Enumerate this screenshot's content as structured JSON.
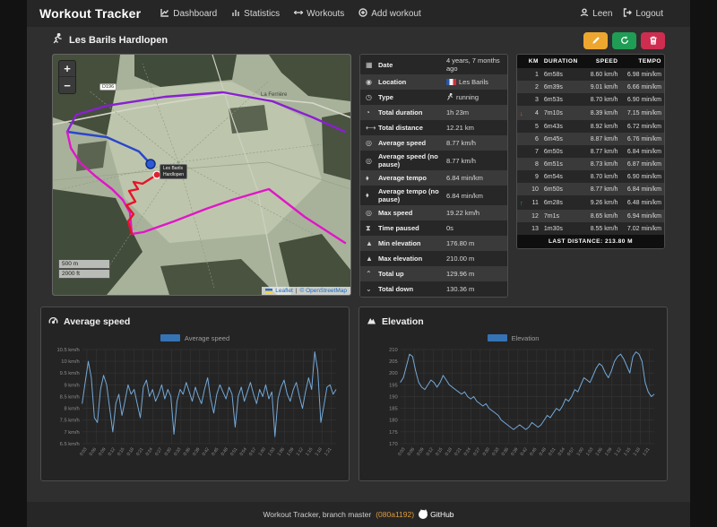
{
  "navbar": {
    "brand": "Workout Tracker",
    "items": [
      {
        "label": "Dashboard",
        "icon": "line-chart-icon"
      },
      {
        "label": "Statistics",
        "icon": "bar-chart-icon"
      },
      {
        "label": "Workouts",
        "icon": "dumbbell-icon"
      },
      {
        "label": "Add workout",
        "icon": "plus-circle-icon"
      }
    ],
    "user": {
      "label": "Leen",
      "icon": "user-icon"
    },
    "logout": {
      "label": "Logout",
      "icon": "logout-icon"
    }
  },
  "page": {
    "title": "Les Barils Hardlopen",
    "title_icon": "runner-icon",
    "actions": {
      "edit": {
        "icon": "pencil-icon",
        "color": "#eda72f"
      },
      "refresh": {
        "icon": "refresh-icon",
        "color": "#1f9d55"
      },
      "delete": {
        "icon": "trash-icon",
        "color": "#ce2d50"
      }
    }
  },
  "map": {
    "zoom_in": "+",
    "zoom_out": "−",
    "scale_metric": "500 m",
    "scale_imperial": "2000 ft",
    "attribution_leaflet": "Leaflet",
    "attribution_sep": "|",
    "attribution_osm": "© OpenStreetMap",
    "road_badge": "D196",
    "place_label": "La Ferrière",
    "tooltip_line1": "Les Barils",
    "tooltip_line2": "Hardlopen",
    "route_colors": {
      "start": "#2b46cc",
      "mid1": "#8a1fd2",
      "mid2": "#e016c8",
      "end": "#e81329"
    }
  },
  "stats": {
    "rows": [
      {
        "icon": "calendar-icon",
        "glyph": "▦",
        "label": "Date",
        "value": "4 years, 7 months ago",
        "value_icon": null
      },
      {
        "icon": "location-pin-icon",
        "glyph": "◉",
        "label": "Location",
        "value": "Les Barils",
        "value_icon": "fr-flag"
      },
      {
        "icon": "stopwatch-icon",
        "glyph": "◷",
        "label": "Type",
        "value": "running",
        "value_icon": "runner-icon"
      },
      {
        "icon": "clock-icon",
        "glyph": "◔",
        "label": "Total duration",
        "value": "1h 23m",
        "value_icon": null
      },
      {
        "icon": "ruler-icon",
        "glyph": "⟷",
        "label": "Total distance",
        "value": "12.21 km",
        "value_icon": null
      },
      {
        "icon": "gauge-icon",
        "glyph": "◎",
        "label": "Average speed",
        "value": "8.77 km/h",
        "value_icon": null
      },
      {
        "icon": "gauge-icon",
        "glyph": "◎",
        "label": "Average speed (no pause)",
        "value": "8.77 km/h",
        "value_icon": null
      },
      {
        "icon": "tempo-drop-icon",
        "glyph": "⬧",
        "label": "Average tempo",
        "value": "6.84 min/km",
        "value_icon": null
      },
      {
        "icon": "tempo-drop-icon",
        "glyph": "⬧",
        "label": "Average tempo (no pause)",
        "value": "6.84 min/km",
        "value_icon": null
      },
      {
        "icon": "gauge-icon",
        "glyph": "◎",
        "label": "Max speed",
        "value": "19.22 km/h",
        "value_icon": null
      },
      {
        "icon": "hourglass-icon",
        "glyph": "⧗",
        "label": "Time paused",
        "value": "0s",
        "value_icon": null
      },
      {
        "icon": "mountain-icon",
        "glyph": "▲",
        "label": "Min elevation",
        "value": "176.80 m",
        "value_icon": null
      },
      {
        "icon": "mountain-icon",
        "glyph": "▲",
        "label": "Max elevation",
        "value": "210.00 m",
        "value_icon": null
      },
      {
        "icon": "chevron-up-icon",
        "glyph": "⌃",
        "label": "Total up",
        "value": "129.96 m",
        "value_icon": null
      },
      {
        "icon": "chevron-down-icon",
        "glyph": "⌄",
        "label": "Total down",
        "value": "130.36 m",
        "value_icon": null
      }
    ]
  },
  "splits": {
    "headers": [
      "KM",
      "DURATION",
      "SPEED",
      "TEMPO"
    ],
    "trend_glyphs": {
      "down": "↓",
      "up": "↑"
    },
    "rows": [
      {
        "km": "1",
        "duration": "6m58s",
        "speed": "8.60 km/h",
        "tempo": "6.98 min/km",
        "trend": ""
      },
      {
        "km": "2",
        "duration": "6m39s",
        "speed": "9.01 km/h",
        "tempo": "6.66 min/km",
        "trend": ""
      },
      {
        "km": "3",
        "duration": "6m53s",
        "speed": "8.70 km/h",
        "tempo": "6.90 min/km",
        "trend": ""
      },
      {
        "km": "4",
        "duration": "7m10s",
        "speed": "8.39 km/h",
        "tempo": "7.15 min/km",
        "trend": "down"
      },
      {
        "km": "5",
        "duration": "6m43s",
        "speed": "8.92 km/h",
        "tempo": "6.72 min/km",
        "trend": ""
      },
      {
        "km": "6",
        "duration": "6m45s",
        "speed": "8.87 km/h",
        "tempo": "6.76 min/km",
        "trend": ""
      },
      {
        "km": "7",
        "duration": "6m50s",
        "speed": "8.77 km/h",
        "tempo": "6.84 min/km",
        "trend": ""
      },
      {
        "km": "8",
        "duration": "6m51s",
        "speed": "8.73 km/h",
        "tempo": "6.87 min/km",
        "trend": ""
      },
      {
        "km": "9",
        "duration": "6m54s",
        "speed": "8.70 km/h",
        "tempo": "6.90 min/km",
        "trend": ""
      },
      {
        "km": "10",
        "duration": "6m50s",
        "speed": "8.77 km/h",
        "tempo": "6.84 min/km",
        "trend": ""
      },
      {
        "km": "11",
        "duration": "6m28s",
        "speed": "9.26 km/h",
        "tempo": "6.48 min/km",
        "trend": "up"
      },
      {
        "km": "12",
        "duration": "7m1s",
        "speed": "8.65 km/h",
        "tempo": "6.94 min/km",
        "trend": ""
      },
      {
        "km": "13",
        "duration": "1m30s",
        "speed": "8.55 km/h",
        "tempo": "7.02 min/km",
        "trend": ""
      }
    ],
    "footer": "LAST DISTANCE: 213.80 M"
  },
  "footer": {
    "text": "Workout Tracker, branch master",
    "commit": "(080a1192)",
    "github_label": "GitHub",
    "github_icon": "github-icon"
  },
  "chart_data": [
    {
      "type": "line",
      "title": "Average speed",
      "title_icon": "gauge-icon",
      "legend": "Average speed",
      "line_color": "#74a9d8",
      "swatch_color": "#3573b5",
      "ylabel": "km/h",
      "ylim": [
        6.5,
        10.5
      ],
      "ytick_values": [
        10.5,
        10,
        9.5,
        9,
        8.5,
        8,
        7.5,
        7,
        6.5
      ],
      "ytick_labels": [
        "10.5 km/h",
        "10 km/h",
        "9.5 km/h",
        "9 km/h",
        "8.5 km/h",
        "8 km/h",
        "7.5 km/h",
        "7 km/h",
        "6.5 km/h"
      ],
      "x_labels": [
        "0:03",
        "0:06",
        "0:09",
        "0:12",
        "0:15",
        "0:18",
        "0:21",
        "0:24",
        "0:27",
        "0:30",
        "0:33",
        "0:36",
        "0:39",
        "0:42",
        "0:45",
        "0:48",
        "0:51",
        "0:54",
        "0:57",
        "1:00",
        "1:03",
        "1:06",
        "1:09",
        "1:12",
        "1:15",
        "1:18",
        "1:21"
      ],
      "grid": true,
      "legend_position": "top-center",
      "values": [
        8.2,
        9.1,
        10.0,
        9.3,
        7.6,
        7.4,
        8.8,
        9.4,
        9.0,
        8.0,
        7.0,
        8.2,
        8.6,
        7.7,
        8.3,
        9.0,
        8.6,
        8.8,
        8.2,
        7.6,
        8.9,
        9.2,
        8.5,
        8.8,
        8.3,
        8.6,
        9.0,
        8.4,
        8.8,
        8.5,
        6.9,
        8.3,
        8.8,
        8.6,
        9.1,
        8.7,
        8.3,
        8.9,
        8.5,
        8.2,
        8.8,
        9.3,
        8.4,
        7.8,
        8.6,
        9.0,
        8.7,
        8.4,
        8.9,
        8.6,
        7.2,
        8.5,
        8.9,
        8.3,
        8.7,
        9.1,
        8.6,
        8.2,
        8.8,
        8.5,
        9.0,
        8.4,
        8.7,
        6.8,
        8.4,
        8.9,
        9.2,
        8.6,
        8.3,
        8.8,
        9.1,
        8.5,
        8.0,
        8.7,
        9.3,
        8.8,
        10.4,
        9.6,
        7.4,
        8.1,
        8.9,
        9.0,
        8.6,
        8.8
      ]
    },
    {
      "type": "line",
      "title": "Elevation",
      "title_icon": "mountain-icon",
      "legend": "Elevation",
      "line_color": "#74a9d8",
      "swatch_color": "#3573b5",
      "ylabel": "m",
      "ylim": [
        170,
        210
      ],
      "ytick_values": [
        210,
        205,
        200,
        195,
        190,
        185,
        180,
        175,
        170
      ],
      "ytick_labels": [
        "210",
        "205",
        "200",
        "195",
        "190",
        "185",
        "180",
        "175",
        "170"
      ],
      "x_labels": [
        "0:03",
        "0:06",
        "0:09",
        "0:12",
        "0:15",
        "0:18",
        "0:21",
        "0:24",
        "0:27",
        "0:30",
        "0:33",
        "0:36",
        "0:39",
        "0:42",
        "0:45",
        "0:48",
        "0:51",
        "0:54",
        "0:57",
        "1:00",
        "1:03",
        "1:06",
        "1:09",
        "1:12",
        "1:15",
        "1:18",
        "1:21"
      ],
      "grid": true,
      "legend_position": "top-center",
      "values": [
        196,
        198,
        203,
        208,
        207,
        201,
        196,
        194,
        193,
        195,
        197,
        196,
        194,
        196,
        199,
        197,
        195,
        194,
        193,
        192,
        191,
        192,
        190,
        189,
        190,
        188,
        187,
        186,
        187,
        185,
        184,
        183,
        182,
        180,
        179,
        178,
        177,
        176,
        177,
        178,
        177,
        176,
        177,
        179,
        178,
        177,
        178,
        180,
        182,
        181,
        183,
        185,
        184,
        186,
        189,
        188,
        190,
        193,
        192,
        195,
        198,
        197,
        196,
        199,
        202,
        204,
        203,
        200,
        198,
        201,
        205,
        207,
        208,
        206,
        203,
        200,
        207,
        209,
        208,
        205,
        196,
        192,
        190,
        191
      ]
    }
  ]
}
